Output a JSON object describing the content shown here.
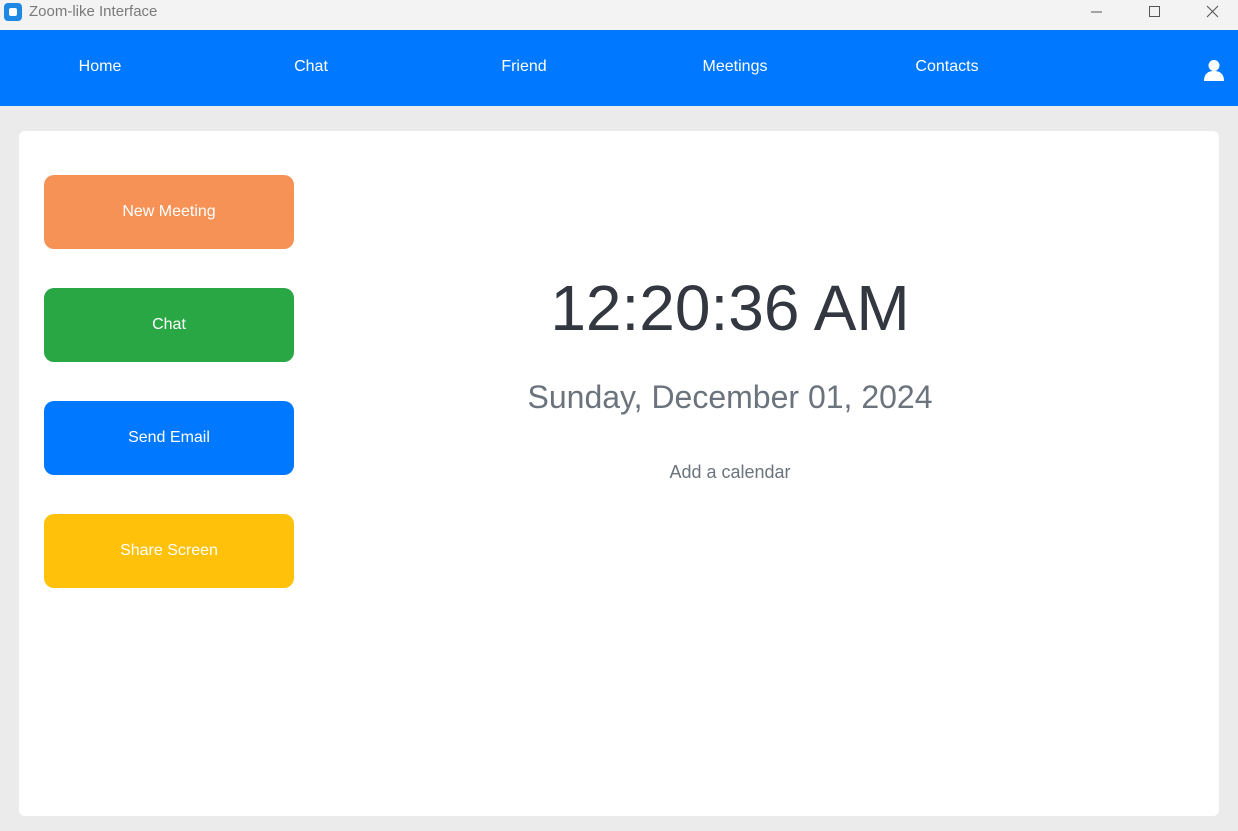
{
  "window": {
    "title": "Zoom-like Interface",
    "app_icon": "app-logo-icon",
    "controls": [
      "minimize-icon",
      "maximize-icon",
      "close-icon"
    ]
  },
  "nav": {
    "background": "#0078ff",
    "items": [
      {
        "label": "Home"
      },
      {
        "label": "Chat"
      },
      {
        "label": "Friend"
      },
      {
        "label": "Meetings"
      },
      {
        "label": "Contacts"
      }
    ],
    "profile_icon": "user-icon"
  },
  "actions": [
    {
      "label": "New Meeting",
      "color": "#f79257"
    },
    {
      "label": "Chat",
      "color": "#29a745"
    },
    {
      "label": "Send Email",
      "color": "#0078ff"
    },
    {
      "label": "Share Screen",
      "color": "#ffc10a"
    }
  ],
  "main": {
    "time": "12:20:36 AM",
    "date": "Sunday, December 01, 2024",
    "calendar_link": "Add a calendar"
  }
}
